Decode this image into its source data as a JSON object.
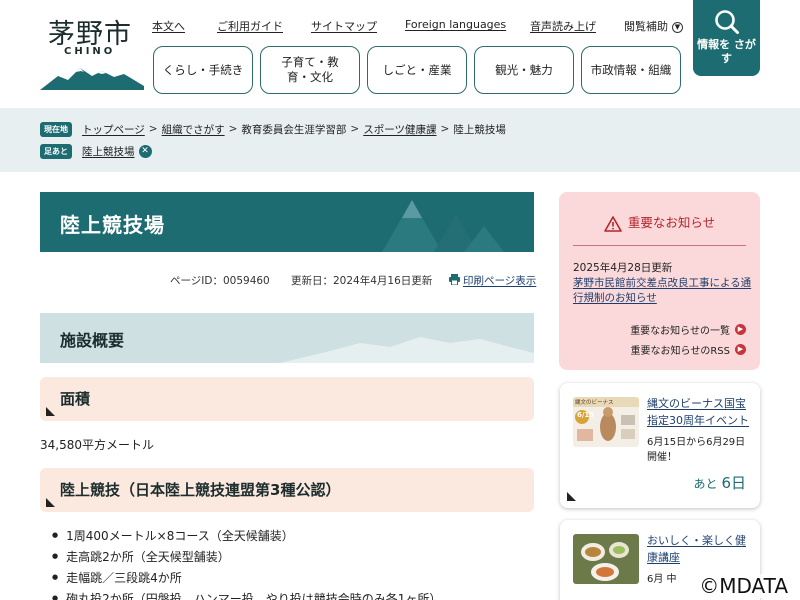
{
  "logo": {
    "title": "茅野市",
    "sub": "CHINO"
  },
  "topnav": [
    "本文へ",
    "ご利用ガイド",
    "サイトマップ",
    "Foreign languages",
    "音声読み上げ",
    "閲覧補助"
  ],
  "mainnav": [
    "くらし・手続き",
    "子育て・教育・文化",
    "しごと・産業",
    "観光・魅力",
    "市政情報・組織"
  ],
  "search": {
    "label": "情報を さがす",
    "icon": "search-icon"
  },
  "breadcrumb": {
    "tag": "現在地",
    "items": [
      "トップページ",
      "組織でさがす",
      "教育委員会生涯学習部",
      "スポーツ健康課",
      "陸上競技場"
    ],
    "separator": ">"
  },
  "footprint": {
    "tag": "足あと",
    "item": "陸上競技場"
  },
  "page": {
    "title": "陸上競技場",
    "page_id": "ページID：0059460",
    "updated": "更新日：2024年4月16日更新",
    "print": "印刷ページ表示"
  },
  "sections": {
    "overview": "施設概要",
    "area_heading": "面積",
    "area_value": "34,580平方メートル",
    "track_heading": "陸上競技（日本陸上競技連盟第3種公認）",
    "track_items": [
      "1周400メートル×8コース（全天候舗装）",
      "走高跳2か所（全天候型舗装）",
      "走幅跳／三段跳4か所",
      "砲丸投2か所（円盤投、ハンマー投、やり投は競技会時のみ各1ヶ所）"
    ]
  },
  "notice": {
    "heading": "重要なお知らせ",
    "date": "2025年4月28日更新",
    "link": "茅野市民館前交差点改良工事による通行規制のお知らせ",
    "more_list": "重要なお知らせの一覧",
    "more_rss": "重要なお知らせのRSS"
  },
  "events": [
    {
      "title": "縄文のビーナス国宝指定30周年イベント",
      "sub": "6月15日から6月29日開催！",
      "count_prefix": "あと",
      "count_value": "6日",
      "thumb_label": "6/15",
      "thumb_caption": "縄文のビーナス"
    },
    {
      "title": "おいしく・楽しく健康講座",
      "sub": "6月 中",
      "count_prefix": "",
      "count_value": ""
    }
  ],
  "copyright": "©MDATA",
  "colors": {
    "teal": "#1d6c72",
    "notice_bg": "#fbd9da",
    "notice_text": "#b3262c",
    "h3_bg": "#fbe9df",
    "h2_bg": "#cfe0e2"
  }
}
